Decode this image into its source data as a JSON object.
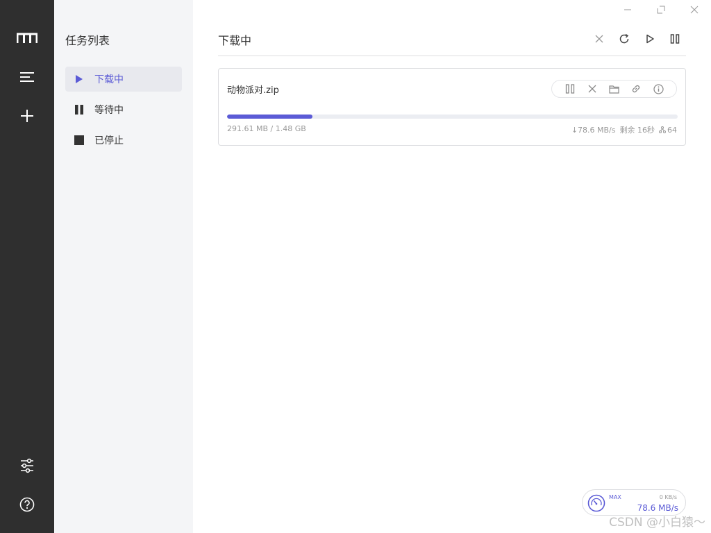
{
  "rail": {
    "icons": [
      "logo-icon",
      "menu-icon",
      "add-icon",
      "preferences-icon",
      "help-icon"
    ]
  },
  "sidebar": {
    "title": "任务列表",
    "items": [
      {
        "label": "下载中",
        "icon": "play-icon",
        "active": true
      },
      {
        "label": "等待中",
        "icon": "pause-icon",
        "active": false
      },
      {
        "label": "已停止",
        "icon": "stop-icon",
        "active": false
      }
    ]
  },
  "window_controls": [
    "minimize-icon",
    "maximize-icon",
    "close-icon"
  ],
  "main": {
    "title": "下载中",
    "header_actions": [
      "delete-all-icon",
      "refresh-icon",
      "resume-all-icon",
      "pause-all-icon"
    ]
  },
  "tasks": [
    {
      "name": "动物派对.zip",
      "progress": 0.19,
      "size": "291.61 MB / 1.48 GB",
      "speed": "↓78.6 MB/s",
      "remaining": "剩余 16秒",
      "connections": "64",
      "actions": [
        "pause-icon",
        "delete-icon",
        "folder-icon",
        "link-icon",
        "info-icon"
      ]
    }
  ],
  "speedometer": {
    "max_label": "MAX",
    "upload": "0 KB/s",
    "download": "78.6 MB/s"
  },
  "watermark": "CSDN @小白猿～",
  "colors": {
    "rail_bg": "#2f2f2f",
    "sidebar_bg": "#f4f5f7",
    "accent": "#5b5bd6"
  }
}
